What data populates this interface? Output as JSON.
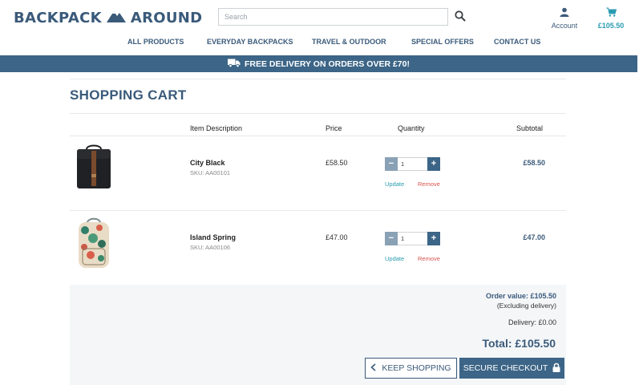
{
  "header": {
    "logo_left": "BACKPACK",
    "logo_right": "AROUND",
    "search_placeholder": "Search",
    "account_label": "Account",
    "cart_total": "£105.50"
  },
  "nav": {
    "items": [
      "ALL PRODUCTS",
      "EVERYDAY BACKPACKS",
      "TRAVEL & OUTDOOR",
      "SPECIAL OFFERS",
      "CONTACT US"
    ]
  },
  "banner": {
    "text": "FREE DELIVERY ON ORDERS OVER £70!"
  },
  "cart": {
    "title": "SHOPPING CART",
    "columns": {
      "description": "Item Description",
      "price": "Price",
      "quantity": "Quantity",
      "subtotal": "Subtotal"
    },
    "items": [
      {
        "name": "City Black",
        "sku": "SKU: AA00101",
        "price": "£58.50",
        "quantity": "1",
        "subtotal": "£58.50",
        "update_label": "Update",
        "remove_label": "Remove"
      },
      {
        "name": "Island Spring",
        "sku": "SKU: AA00106",
        "price": "£47.00",
        "quantity": "1",
        "subtotal": "£47.00",
        "update_label": "Update",
        "remove_label": "Remove"
      }
    ],
    "summary": {
      "order_value": "Order value: £105.50",
      "excl_delivery": "(Excluding delivery)",
      "delivery": "Delivery: £0.00",
      "total": "Total: £105.50"
    },
    "buttons": {
      "keep_shopping": "KEEP SHOPPING",
      "checkout": "SECURE CHECKOUT"
    }
  },
  "colors": {
    "brand": "#3c6587",
    "accent": "#2a9cb0",
    "remove": "#d9534f"
  },
  "icons": [
    "mountain-logo-icon",
    "search-icon",
    "user-icon",
    "cart-icon",
    "truck-icon",
    "minus-icon",
    "plus-icon",
    "chevron-left-icon",
    "lock-icon"
  ]
}
